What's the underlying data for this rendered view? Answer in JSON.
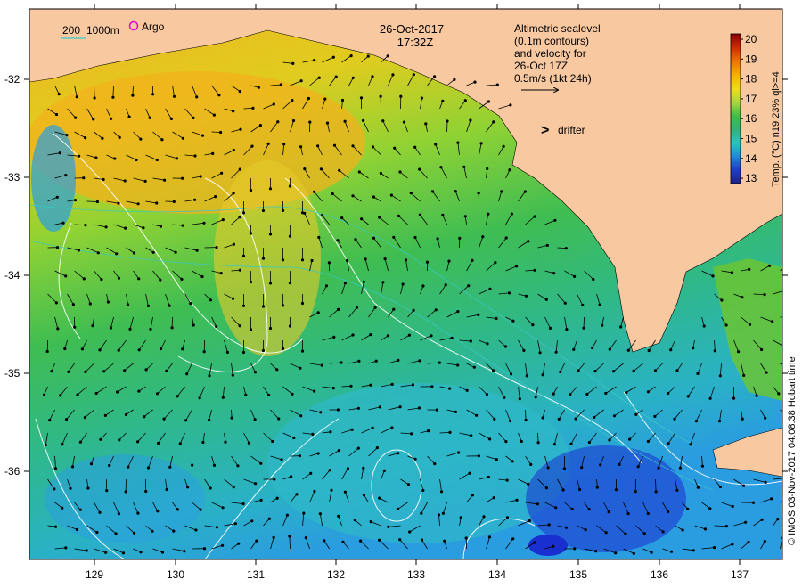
{
  "header": {
    "date": "26-Oct-2017",
    "time": "17:32Z"
  },
  "depth_legend": {
    "shallow": "200",
    "deep": "1000m",
    "line_color": "#36c9c9"
  },
  "argo": {
    "label": "Argo",
    "symbol_color": "#e000e0"
  },
  "drifter": {
    "label": "drifter",
    "symbol": ">",
    "symbol_color": "#e000e0"
  },
  "altimetry_note": {
    "lines": [
      "Altimetric sealevel",
      "(0.1m contours)",
      "and velocity for",
      "26-Oct 17Z",
      "0.5m/s (1kt 24h)"
    ]
  },
  "colorbar": {
    "ticks": [
      "20",
      "19",
      "18",
      "17",
      "16",
      "15",
      "14",
      "13"
    ],
    "title": "Temp. (°C) n19 23% ql>=4",
    "colors": [
      "#8b0000",
      "#cc2b00",
      "#ee7000",
      "#f5b400",
      "#eedd20",
      "#a9d540",
      "#3bbf44",
      "#2fb37a",
      "#26c6c0",
      "#1a8ae0",
      "#1e3cc8",
      "#20208a"
    ]
  },
  "axes": {
    "x_ticks": [
      "129",
      "130",
      "131",
      "132",
      "133",
      "134",
      "135",
      "136",
      "137"
    ],
    "y_ticks": [
      "-32",
      "-33",
      "-34",
      "-35",
      "-36"
    ]
  },
  "credit": "© IMOS 03-Nov-2017 04:08:38 Hobart time",
  "colors": {
    "land": "#f8c8a0",
    "sst_warm": "#f2b21c",
    "sst_mid": "#6ec62c",
    "sst_cool": "#2fb883",
    "sst_cold": "#2a9ee0",
    "sst_coldest": "#1a2fd0"
  }
}
